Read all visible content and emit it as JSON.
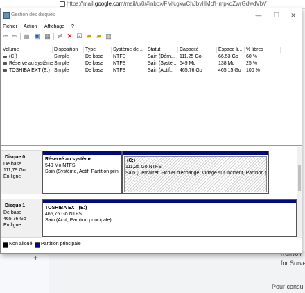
{
  "browser": {
    "url_prefix": "https://mail.",
    "url_domain": "google.com",
    "url_rest": "/mail/u/0/#inbox/FMfcgxwChJbvHMcfHmpkqZwrGdwdVbV"
  },
  "window": {
    "title": "Gestion des disques",
    "min": "—",
    "max": "☐",
    "close": "✕"
  },
  "menu": [
    "Fichier",
    "Action",
    "Affichage",
    "?"
  ],
  "volume_table": {
    "headers": [
      "Volume",
      "Disposition",
      "Type",
      "Système de ...",
      "Statut",
      "Capacité",
      "Espace li...",
      "% libres"
    ],
    "rows": [
      [
        "(C:)",
        "Simple",
        "De base",
        "NTFS",
        "Sain (Dém...",
        "111,25 Go",
        "66,53 Go",
        "60 %"
      ],
      [
        "Réservé au système",
        "Simple",
        "De base",
        "NTFS",
        "Sain (Systè...",
        "549 Mo",
        "138 Mo",
        "25 %"
      ],
      [
        "TOSHIBA EXT (E:)",
        "Simple",
        "De base",
        "NTFS",
        "Sain (Actif...",
        "465,76 Go",
        "465,15 Go",
        "100 %"
      ]
    ]
  },
  "disks": [
    {
      "name": "Disque 0",
      "type": "De base",
      "size": "111,79 Go",
      "status": "En ligne",
      "partitions": [
        {
          "name": "Réservé au système",
          "size": "549 Mo NTFS",
          "status": "Sain (Système, Actif, Partition prin"
        },
        {
          "name": "(C:)",
          "size": "111,25 Go NTFS",
          "status": "Sain (Démarrer, Fichier d'échange, Vidage sur incident, Partition p"
        }
      ]
    },
    {
      "name": "Disque 1",
      "type": "De base",
      "size": "465,76 Go",
      "status": "En ligne",
      "partitions": [
        {
          "name": "TOSHIBA EXT  (E:)",
          "size": "465,76 Go NTFS",
          "status": "Sain (Actif, Partition principale)"
        }
      ]
    }
  ],
  "legend": {
    "unallocated": "Non alloué",
    "primary": "Partition principale",
    "unallocated_color": "#000000",
    "primary_color": "#000a78"
  },
  "background": {
    "plus": "+",
    "text1": "rronvoil",
    "text2": "for Surve",
    "text3": "Pour consu"
  }
}
